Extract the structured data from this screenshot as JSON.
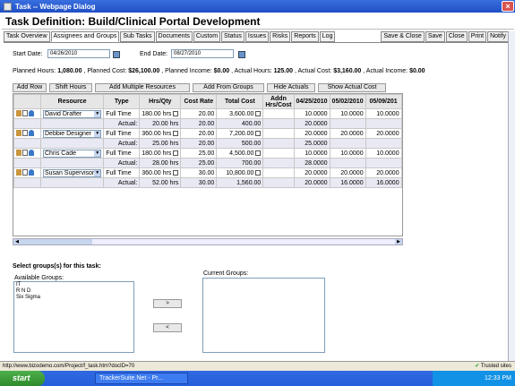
{
  "window": {
    "title": "Task -- Webpage Dialog"
  },
  "page": {
    "title": "Task Definition: Build/Clinical Portal Development"
  },
  "tabs": [
    "Task Overview",
    "Assignees and Groups",
    "Sub Tasks",
    "Documents",
    "Custom",
    "Status",
    "Issues",
    "Risks",
    "Reports",
    "Log"
  ],
  "actions": [
    "Save & Close",
    "Save",
    "Close",
    "Print",
    "Notify"
  ],
  "dates": {
    "start_label": "Start Date:",
    "start_value": "04/26/2010",
    "end_label": "End Date:",
    "end_value": "08/27/2010"
  },
  "summary": {
    "planned_hours_label": "Planned Hours:",
    "planned_hours": "1,080.00",
    "planned_cost_label": "Planned Cost:",
    "planned_cost": "$26,100.00",
    "planned_income_label": "Planned Income:",
    "planned_income": "$0.00",
    "actual_hours_label": "Actual Hours:",
    "actual_hours": "125.00",
    "actual_cost_label": "Actual Cost:",
    "actual_cost": "$3,160.00",
    "actual_income_label": "Actual Income:",
    "actual_income": "$0.00"
  },
  "toolbar": [
    "Add Row",
    "Shift Hours",
    "Add Multiple Resources",
    "Add From Groups",
    "Hide Actuals",
    "Show Actual Cost"
  ],
  "grid": {
    "headers": [
      "Resource",
      "Type",
      "Hrs/Qty",
      "Cost Rate",
      "Total Cost",
      "Addn Hrs/Cost",
      "04/25/2010",
      "05/02/2010",
      "05/09/201"
    ],
    "actual_label": "Actual:",
    "hrs_unit": "hrs",
    "rows": [
      {
        "resource": "David Drafter",
        "type": "Full Time",
        "hrs": "180.00",
        "rate": "20.00",
        "total": "3,600.00",
        "d1": "10.0000",
        "d2": "10.0000",
        "d3": "10.0000",
        "a_hrs": "20.00",
        "a_rate": "20.00",
        "a_total": "400.00",
        "a_d1": "20.0000",
        "a_d2": "",
        "a_d3": ""
      },
      {
        "resource": "Debbie Designer",
        "type": "Full Time",
        "hrs": "360.00",
        "rate": "20.00",
        "total": "7,200.00",
        "d1": "20.0000",
        "d2": "20.0000",
        "d3": "20.0000",
        "a_hrs": "25.00",
        "a_rate": "20.00",
        "a_total": "500.00",
        "a_d1": "25.0000",
        "a_d2": "",
        "a_d3": ""
      },
      {
        "resource": "Chris Cade",
        "type": "Full Time",
        "hrs": "180.00",
        "rate": "25.00",
        "total": "4,500.00",
        "d1": "10.0000",
        "d2": "10.0000",
        "d3": "10.0000",
        "a_hrs": "28.00",
        "a_rate": "25.00",
        "a_total": "700.00",
        "a_d1": "28.0000",
        "a_d2": "",
        "a_d3": ""
      },
      {
        "resource": "Susan Supervisor",
        "type": "Full Time",
        "hrs": "360.00",
        "rate": "30.00",
        "total": "10,800.00",
        "d1": "20.0000",
        "d2": "20.0000",
        "d3": "20.0000",
        "a_hrs": "52.00",
        "a_rate": "30.00",
        "a_total": "1,560.00",
        "a_d1": "20.0000",
        "a_d2": "16.0000",
        "a_d3": "16.0000"
      }
    ]
  },
  "groups": {
    "prompt": "Select groups(s) for this task:",
    "available_label": "Available Groups:",
    "available": [
      "IT",
      "R N D",
      "Six Sigma"
    ],
    "current_label": "Current Groups:",
    "add_btn": ">",
    "remove_btn": "<"
  },
  "status": {
    "url": "http://www.bizodemo.com/Project/f_task.htm?docID=70",
    "zone": "Trusted sites"
  },
  "taskbar": {
    "start": "start",
    "task": "TrackerSuite.Net - Pr...",
    "clock": "12:33 PM"
  }
}
